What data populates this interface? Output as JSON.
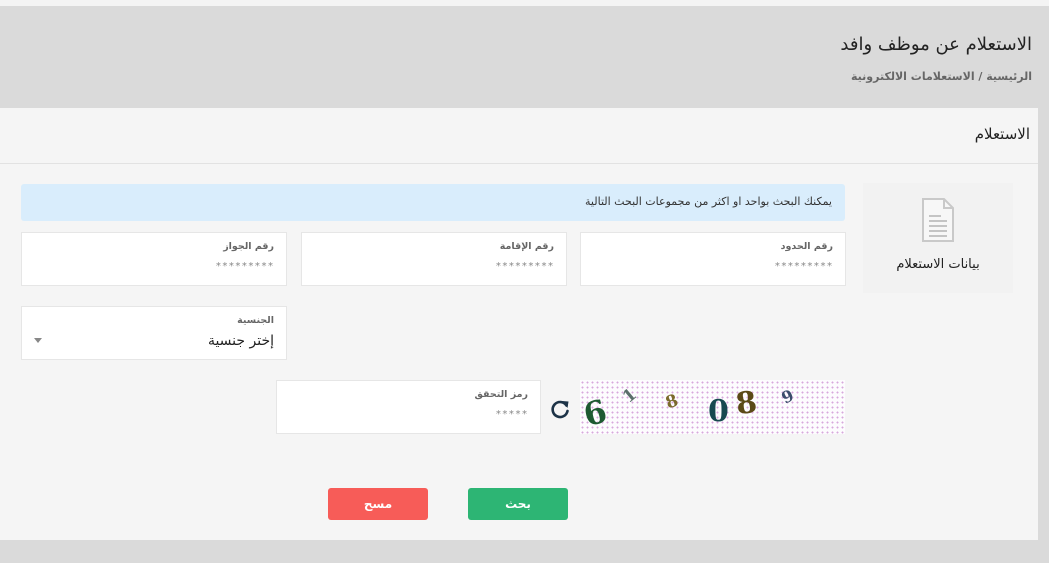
{
  "header": {
    "title": "الاستعلام عن موظف وافد",
    "breadcrumb": "الرئيسية / الاستعلامات الالكترونية"
  },
  "card": {
    "title": "الاستعلام",
    "side_tab": {
      "label": "بيانات الاستعلام",
      "icon": "document-icon"
    },
    "alert": "يمكنك البحث بواحد او اكثر من مجموعات البحث التالية",
    "fields": {
      "border_number": {
        "label": "رقم الحدود",
        "placeholder": "*********",
        "value": ""
      },
      "iqama_number": {
        "label": "رقم الإقامة",
        "placeholder": "*********",
        "value": ""
      },
      "passport_number": {
        "label": "رقم الجواز",
        "placeholder": "*********",
        "value": ""
      },
      "nationality": {
        "label": "الجنسية",
        "selected": "إختر جنسية"
      },
      "captcha_code": {
        "label": "رمز التحقق",
        "placeholder": "*****",
        "value": ""
      }
    },
    "captcha": {
      "characters": [
        "6",
        "1",
        "8",
        "0",
        "8",
        "9"
      ],
      "refresh_icon": "refresh-icon"
    },
    "buttons": {
      "search": "بحث",
      "clear": "مسح"
    }
  },
  "colors": {
    "search_button": "#2db574",
    "clear_button": "#f75c58",
    "alert_background": "#d9edfc",
    "page_background": "#dadada",
    "card_background": "#f5f5f5"
  }
}
